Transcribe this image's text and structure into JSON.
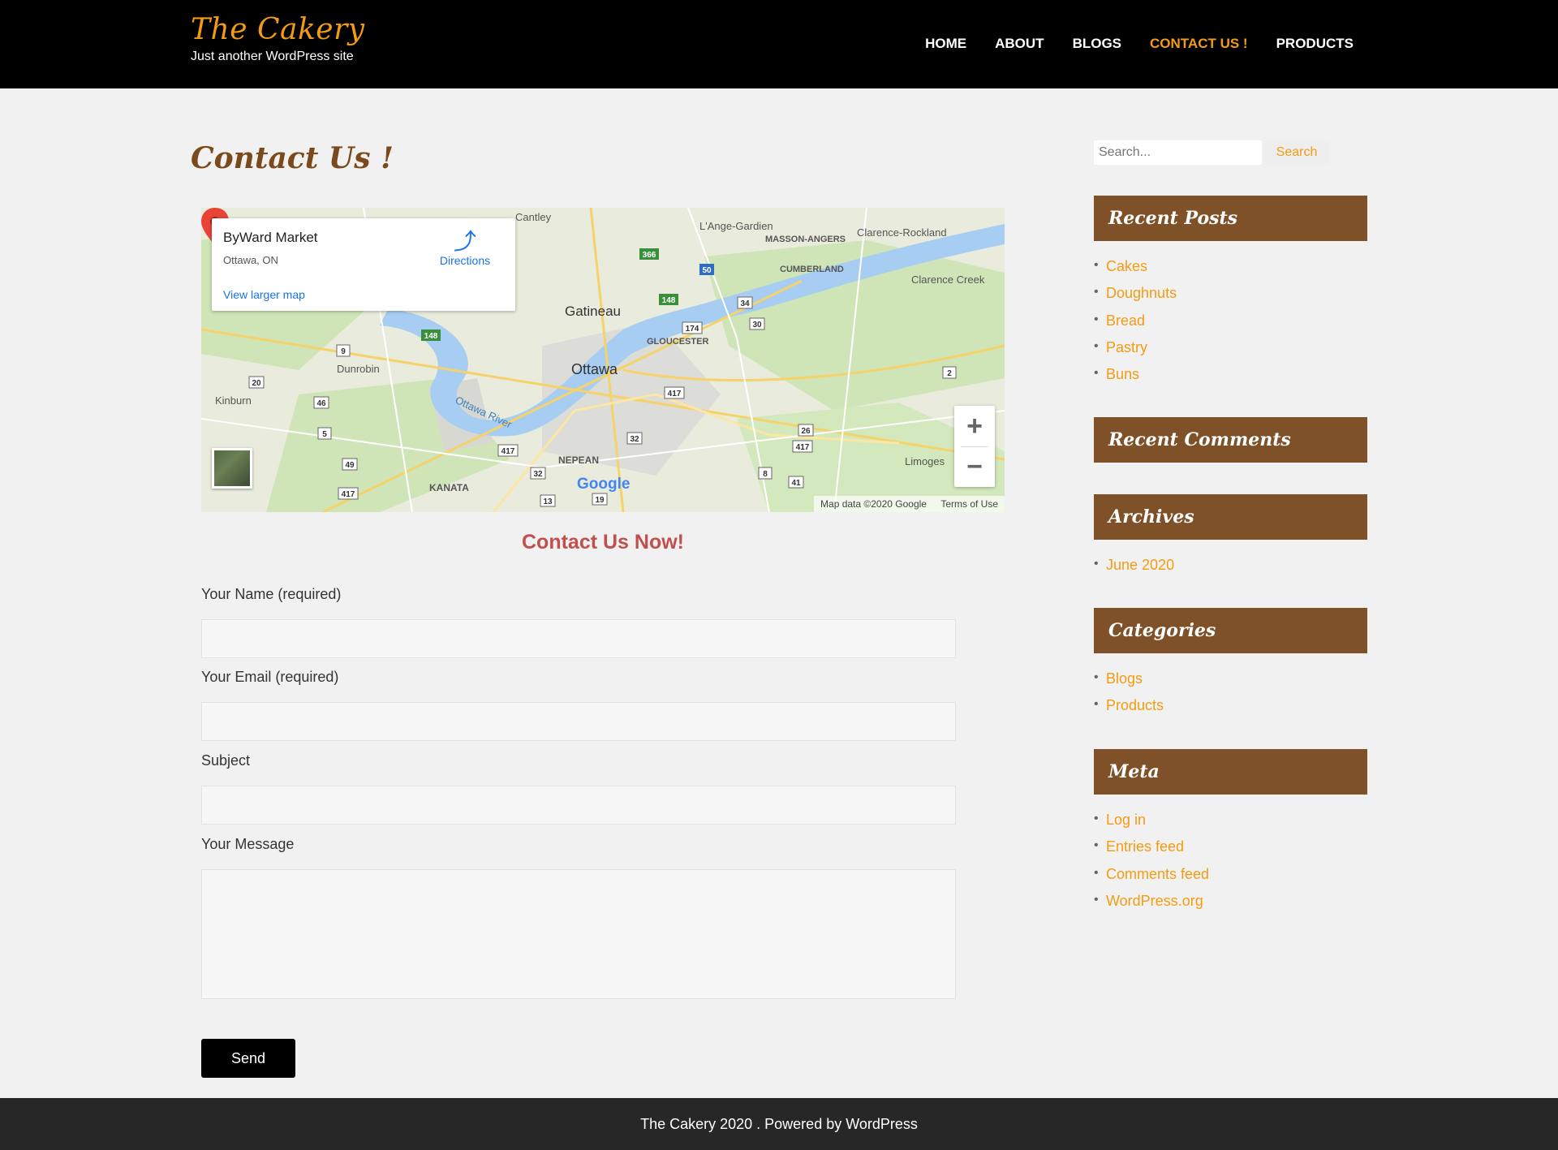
{
  "site": {
    "title": "The Cakery",
    "tagline": "Just another WordPress site"
  },
  "nav": [
    {
      "label": "HOME"
    },
    {
      "label": "ABOUT"
    },
    {
      "label": "BLOGS"
    },
    {
      "label": "CONTACT US !"
    },
    {
      "label": "PRODUCTS"
    }
  ],
  "page": {
    "title": "Contact Us !"
  },
  "map": {
    "place": "ByWard Market",
    "address": "Ottawa, ON",
    "directions": "Directions",
    "larger": "View larger map",
    "footer_data": "Map data ©2020 Google",
    "footer_terms": "Terms of Use",
    "google": "Google",
    "labels": [
      {
        "name": "Cantley"
      },
      {
        "name": "L'Ange-Gardien"
      },
      {
        "name": "MASSON-ANGERS"
      },
      {
        "name": "Clarence-Rockland"
      },
      {
        "name": "CUMBERLAND"
      },
      {
        "name": "Clarence Creek"
      },
      {
        "name": "Gatineau"
      },
      {
        "name": "GLOUCESTER"
      },
      {
        "name": "Ottawa"
      },
      {
        "name": "Dunrobin"
      },
      {
        "name": "Kinburn"
      },
      {
        "name": "Ottawa River"
      },
      {
        "name": "NEPEAN"
      },
      {
        "name": "KANATA"
      },
      {
        "name": "Limoges"
      }
    ],
    "shields": [
      "366",
      "50",
      "148",
      "34",
      "174",
      "30",
      "148",
      "9",
      "20",
      "46",
      "5",
      "2",
      "417",
      "26",
      "417",
      "32",
      "417",
      "32",
      "13",
      "19",
      "8",
      "41",
      "49",
      "417"
    ],
    "zoom_in": "+",
    "zoom_out": "−"
  },
  "form": {
    "heading": "Contact Us Now!",
    "name_label": "Your Name (required)",
    "email_label": "Your Email (required)",
    "subject_label": "Subject",
    "message_label": "Your Message",
    "send": "Send"
  },
  "sidebar": {
    "search_placeholder": "Search...",
    "search_button": "Search",
    "recent_posts": {
      "title": "Recent Posts",
      "items": [
        "Cakes",
        "Doughnuts",
        "Bread",
        "Pastry",
        "Buns"
      ]
    },
    "recent_comments": {
      "title": "Recent Comments"
    },
    "archives": {
      "title": "Archives",
      "items": [
        "June 2020"
      ]
    },
    "categories": {
      "title": "Categories",
      "items": [
        "Blogs",
        "Products"
      ]
    },
    "meta": {
      "title": "Meta",
      "items": [
        "Log in",
        "Entries feed",
        "Comments feed",
        "WordPress.org"
      ]
    }
  },
  "footer": {
    "text": "The Cakery 2020 . Powered by WordPress"
  },
  "colors": {
    "accent": "#f39c12",
    "widget_bg": "#7f5128",
    "heading": "#c0504d",
    "header_bg": "#000000",
    "footer_bg": "#272727"
  }
}
